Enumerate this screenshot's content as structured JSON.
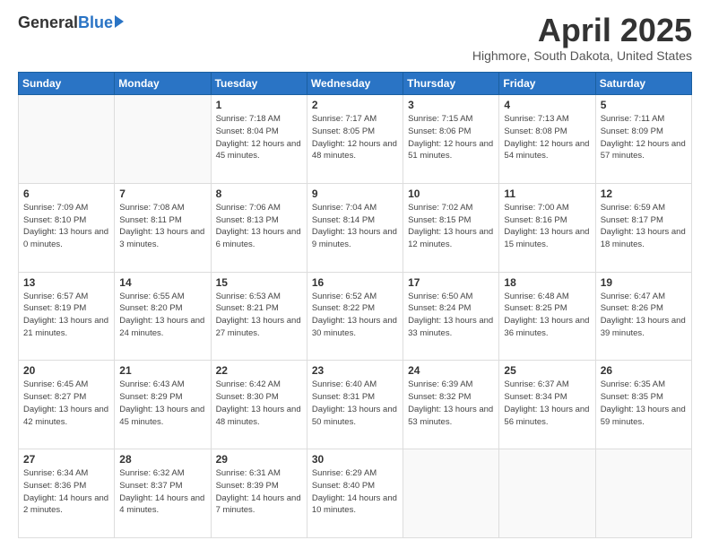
{
  "header": {
    "logo_general": "General",
    "logo_blue": "Blue",
    "month_title": "April 2025",
    "location": "Highmore, South Dakota, United States"
  },
  "days_of_week": [
    "Sunday",
    "Monday",
    "Tuesday",
    "Wednesday",
    "Thursday",
    "Friday",
    "Saturday"
  ],
  "weeks": [
    [
      {
        "day": "",
        "info": ""
      },
      {
        "day": "",
        "info": ""
      },
      {
        "day": "1",
        "info": "Sunrise: 7:18 AM\nSunset: 8:04 PM\nDaylight: 12 hours and 45 minutes."
      },
      {
        "day": "2",
        "info": "Sunrise: 7:17 AM\nSunset: 8:05 PM\nDaylight: 12 hours and 48 minutes."
      },
      {
        "day": "3",
        "info": "Sunrise: 7:15 AM\nSunset: 8:06 PM\nDaylight: 12 hours and 51 minutes."
      },
      {
        "day": "4",
        "info": "Sunrise: 7:13 AM\nSunset: 8:08 PM\nDaylight: 12 hours and 54 minutes."
      },
      {
        "day": "5",
        "info": "Sunrise: 7:11 AM\nSunset: 8:09 PM\nDaylight: 12 hours and 57 minutes."
      }
    ],
    [
      {
        "day": "6",
        "info": "Sunrise: 7:09 AM\nSunset: 8:10 PM\nDaylight: 13 hours and 0 minutes."
      },
      {
        "day": "7",
        "info": "Sunrise: 7:08 AM\nSunset: 8:11 PM\nDaylight: 13 hours and 3 minutes."
      },
      {
        "day": "8",
        "info": "Sunrise: 7:06 AM\nSunset: 8:13 PM\nDaylight: 13 hours and 6 minutes."
      },
      {
        "day": "9",
        "info": "Sunrise: 7:04 AM\nSunset: 8:14 PM\nDaylight: 13 hours and 9 minutes."
      },
      {
        "day": "10",
        "info": "Sunrise: 7:02 AM\nSunset: 8:15 PM\nDaylight: 13 hours and 12 minutes."
      },
      {
        "day": "11",
        "info": "Sunrise: 7:00 AM\nSunset: 8:16 PM\nDaylight: 13 hours and 15 minutes."
      },
      {
        "day": "12",
        "info": "Sunrise: 6:59 AM\nSunset: 8:17 PM\nDaylight: 13 hours and 18 minutes."
      }
    ],
    [
      {
        "day": "13",
        "info": "Sunrise: 6:57 AM\nSunset: 8:19 PM\nDaylight: 13 hours and 21 minutes."
      },
      {
        "day": "14",
        "info": "Sunrise: 6:55 AM\nSunset: 8:20 PM\nDaylight: 13 hours and 24 minutes."
      },
      {
        "day": "15",
        "info": "Sunrise: 6:53 AM\nSunset: 8:21 PM\nDaylight: 13 hours and 27 minutes."
      },
      {
        "day": "16",
        "info": "Sunrise: 6:52 AM\nSunset: 8:22 PM\nDaylight: 13 hours and 30 minutes."
      },
      {
        "day": "17",
        "info": "Sunrise: 6:50 AM\nSunset: 8:24 PM\nDaylight: 13 hours and 33 minutes."
      },
      {
        "day": "18",
        "info": "Sunrise: 6:48 AM\nSunset: 8:25 PM\nDaylight: 13 hours and 36 minutes."
      },
      {
        "day": "19",
        "info": "Sunrise: 6:47 AM\nSunset: 8:26 PM\nDaylight: 13 hours and 39 minutes."
      }
    ],
    [
      {
        "day": "20",
        "info": "Sunrise: 6:45 AM\nSunset: 8:27 PM\nDaylight: 13 hours and 42 minutes."
      },
      {
        "day": "21",
        "info": "Sunrise: 6:43 AM\nSunset: 8:29 PM\nDaylight: 13 hours and 45 minutes."
      },
      {
        "day": "22",
        "info": "Sunrise: 6:42 AM\nSunset: 8:30 PM\nDaylight: 13 hours and 48 minutes."
      },
      {
        "day": "23",
        "info": "Sunrise: 6:40 AM\nSunset: 8:31 PM\nDaylight: 13 hours and 50 minutes."
      },
      {
        "day": "24",
        "info": "Sunrise: 6:39 AM\nSunset: 8:32 PM\nDaylight: 13 hours and 53 minutes."
      },
      {
        "day": "25",
        "info": "Sunrise: 6:37 AM\nSunset: 8:34 PM\nDaylight: 13 hours and 56 minutes."
      },
      {
        "day": "26",
        "info": "Sunrise: 6:35 AM\nSunset: 8:35 PM\nDaylight: 13 hours and 59 minutes."
      }
    ],
    [
      {
        "day": "27",
        "info": "Sunrise: 6:34 AM\nSunset: 8:36 PM\nDaylight: 14 hours and 2 minutes."
      },
      {
        "day": "28",
        "info": "Sunrise: 6:32 AM\nSunset: 8:37 PM\nDaylight: 14 hours and 4 minutes."
      },
      {
        "day": "29",
        "info": "Sunrise: 6:31 AM\nSunset: 8:39 PM\nDaylight: 14 hours and 7 minutes."
      },
      {
        "day": "30",
        "info": "Sunrise: 6:29 AM\nSunset: 8:40 PM\nDaylight: 14 hours and 10 minutes."
      },
      {
        "day": "",
        "info": ""
      },
      {
        "day": "",
        "info": ""
      },
      {
        "day": "",
        "info": ""
      }
    ]
  ]
}
